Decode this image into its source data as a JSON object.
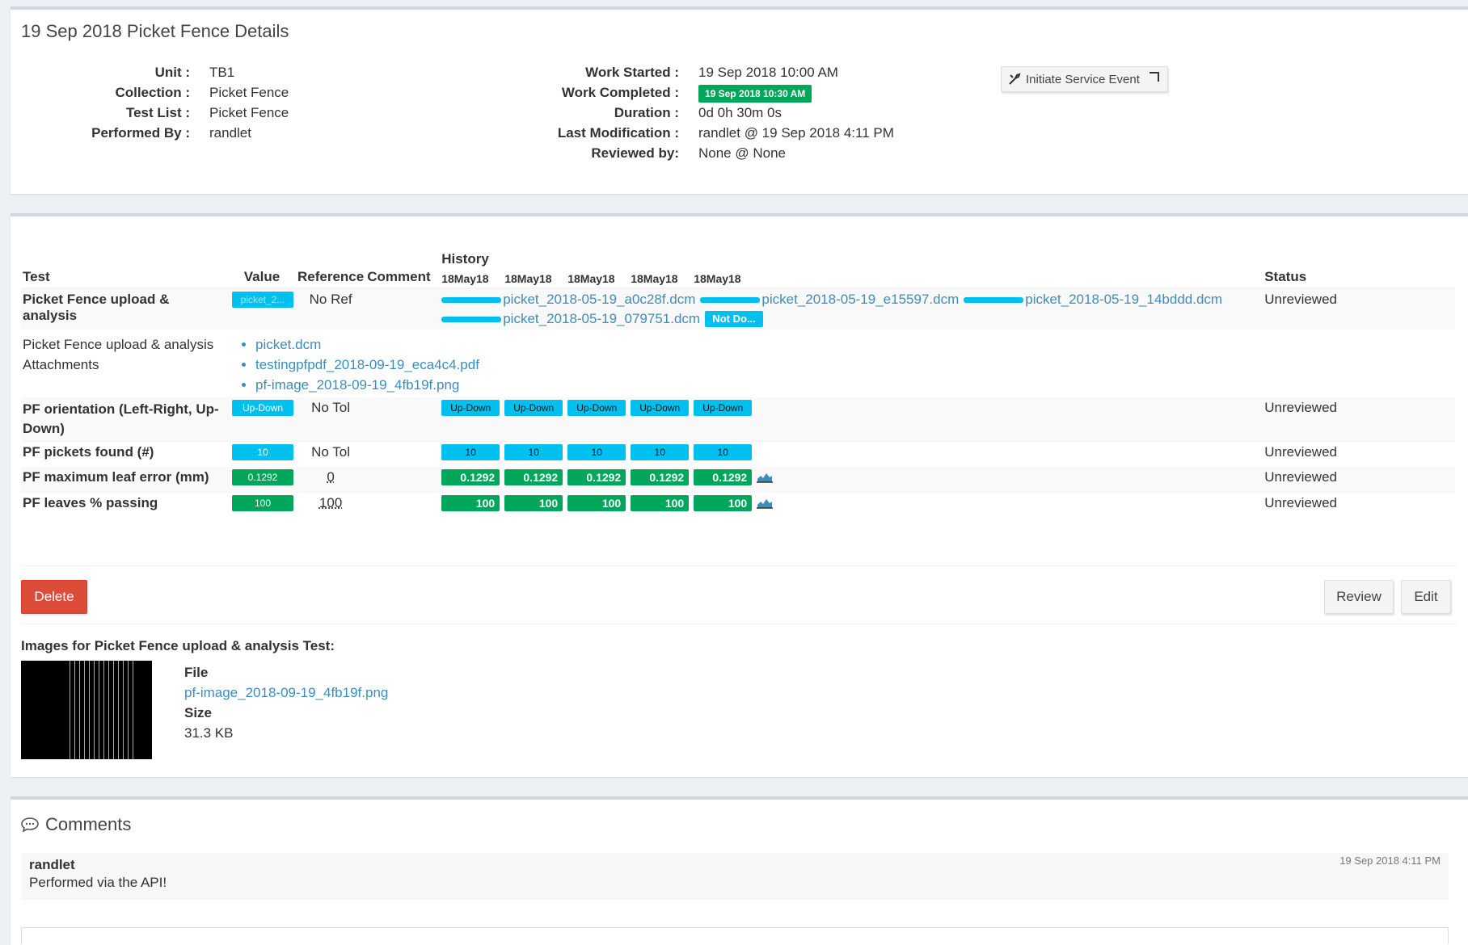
{
  "details": {
    "title": "19 Sep 2018 Picket Fence Details",
    "left": [
      {
        "label": "Unit :",
        "value": "TB1"
      },
      {
        "label": "Collection :",
        "value": "Picket Fence"
      },
      {
        "label": "Test List :",
        "value": "Picket Fence"
      },
      {
        "label": "Performed By :",
        "value": "randlet"
      }
    ],
    "right": {
      "work_started_label": "Work Started :",
      "work_started": "19 Sep 2018 10:00 AM",
      "work_completed_label": "Work Completed :",
      "work_completed": "19 Sep 2018 10:30 AM",
      "duration_label": "Duration :",
      "duration": "0d 0h 30m 0s",
      "last_mod_label": "Last Modification :",
      "last_mod": "randlet @ 19 Sep 2018 4:11 PM",
      "reviewed_label": "Reviewed by:",
      "reviewed": "None @ None"
    },
    "service_button": "Initiate Service Event"
  },
  "tests": {
    "headers": {
      "test": "Test",
      "value": "Value",
      "reference": "Reference",
      "comment": "Comment",
      "history": "History",
      "status": "Status"
    },
    "history_dates": [
      "18May18",
      "18May18",
      "18May18",
      "18May18",
      "18May18"
    ],
    "rows": [
      {
        "name": "Picket Fence upload & analysis",
        "value": "picket_2...",
        "reference": "No Ref",
        "status": "Unreviewed",
        "history_files": [
          "picket_2018-05-19_a0c28f.dcm",
          "picket_2018-05-19_e15597.dcm",
          "picket_2018-05-19_14bddd.dcm",
          "picket_2018-05-19_079751.dcm"
        ],
        "not_done": "Not Do..."
      },
      {
        "name": "PF orientation (Left-Right, Up-Down)",
        "value": "Up-Down",
        "reference": "No Tol",
        "status": "Unreviewed",
        "history": [
          "Up-Down",
          "Up-Down",
          "Up-Down",
          "Up-Down",
          "Up-Down"
        ]
      },
      {
        "name": "PF pickets found (#)",
        "value": "10",
        "reference": "No Tol",
        "status": "Unreviewed",
        "history": [
          "10",
          "10",
          "10",
          "10",
          "10"
        ]
      },
      {
        "name": "PF maximum leaf error (mm)",
        "value": "0.1292",
        "reference": "0",
        "status": "Unreviewed",
        "history": [
          "0.1292",
          "0.1292",
          "0.1292",
          "0.1292",
          "0.1292"
        ]
      },
      {
        "name": "PF leaves % passing",
        "value": "100",
        "reference": "100",
        "status": "Unreviewed",
        "history": [
          "100",
          "100",
          "100",
          "100",
          "100"
        ]
      }
    ],
    "attachments": {
      "label": "Picket Fence upload & analysis Attachments",
      "files": [
        "picket.dcm",
        "testingpfpdf_2018-09-19_eca4c4.pdf",
        "pf-image_2018-09-19_4fb19f.png"
      ]
    }
  },
  "actions": {
    "delete": "Delete",
    "review": "Review",
    "edit": "Edit"
  },
  "images": {
    "title": "Images for Picket Fence upload & analysis Test:",
    "file_label": "File",
    "file_name": "pf-image_2018-09-19_4fb19f.png",
    "size_label": "Size",
    "size": "31.3 KB"
  },
  "comments": {
    "title": "Comments",
    "items": [
      {
        "author": "randlet",
        "date": "19 Sep 2018 4:11 PM",
        "text": "Performed via the API!"
      }
    ]
  },
  "colors": {
    "info": "#00c0ef",
    "success": "#00a65a",
    "danger": "#dd4b39",
    "link": "#3c8dbc"
  }
}
